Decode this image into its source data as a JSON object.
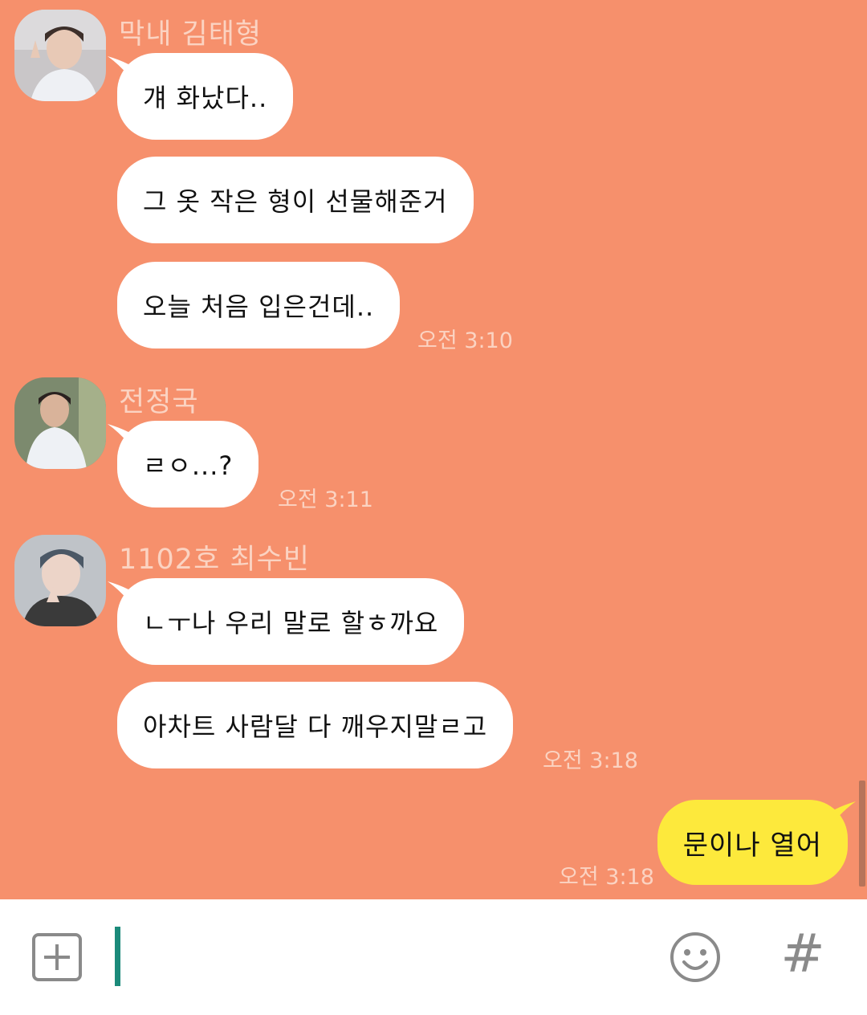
{
  "groups": [
    {
      "sender": "막내 김태형",
      "messages": [
        "걔 화났다..",
        "그 옷 작은 형이 선물해준거",
        "오늘 처음 입은건데.."
      ],
      "time": "오전 3:10"
    },
    {
      "sender": "전정국",
      "messages": [
        "ㄹㅇ...?"
      ],
      "time": "오전 3:11"
    },
    {
      "sender": "1102호 최수빈",
      "messages": [
        "ㄴㅜ나 우리 말로 할ㅎ까요",
        "아차트 사람달 다 깨우지말ㄹ고"
      ],
      "time": "오전 3:18"
    }
  ],
  "mine": {
    "message": "문이나 열어",
    "time": "오전 3:18"
  },
  "inputbar": {
    "placeholder": "",
    "hash_label": "#"
  },
  "colors": {
    "background": "#f6906c",
    "my_bubble": "#fde93c",
    "their_bubble": "#ffffff",
    "caret": "#1b8a7a"
  }
}
